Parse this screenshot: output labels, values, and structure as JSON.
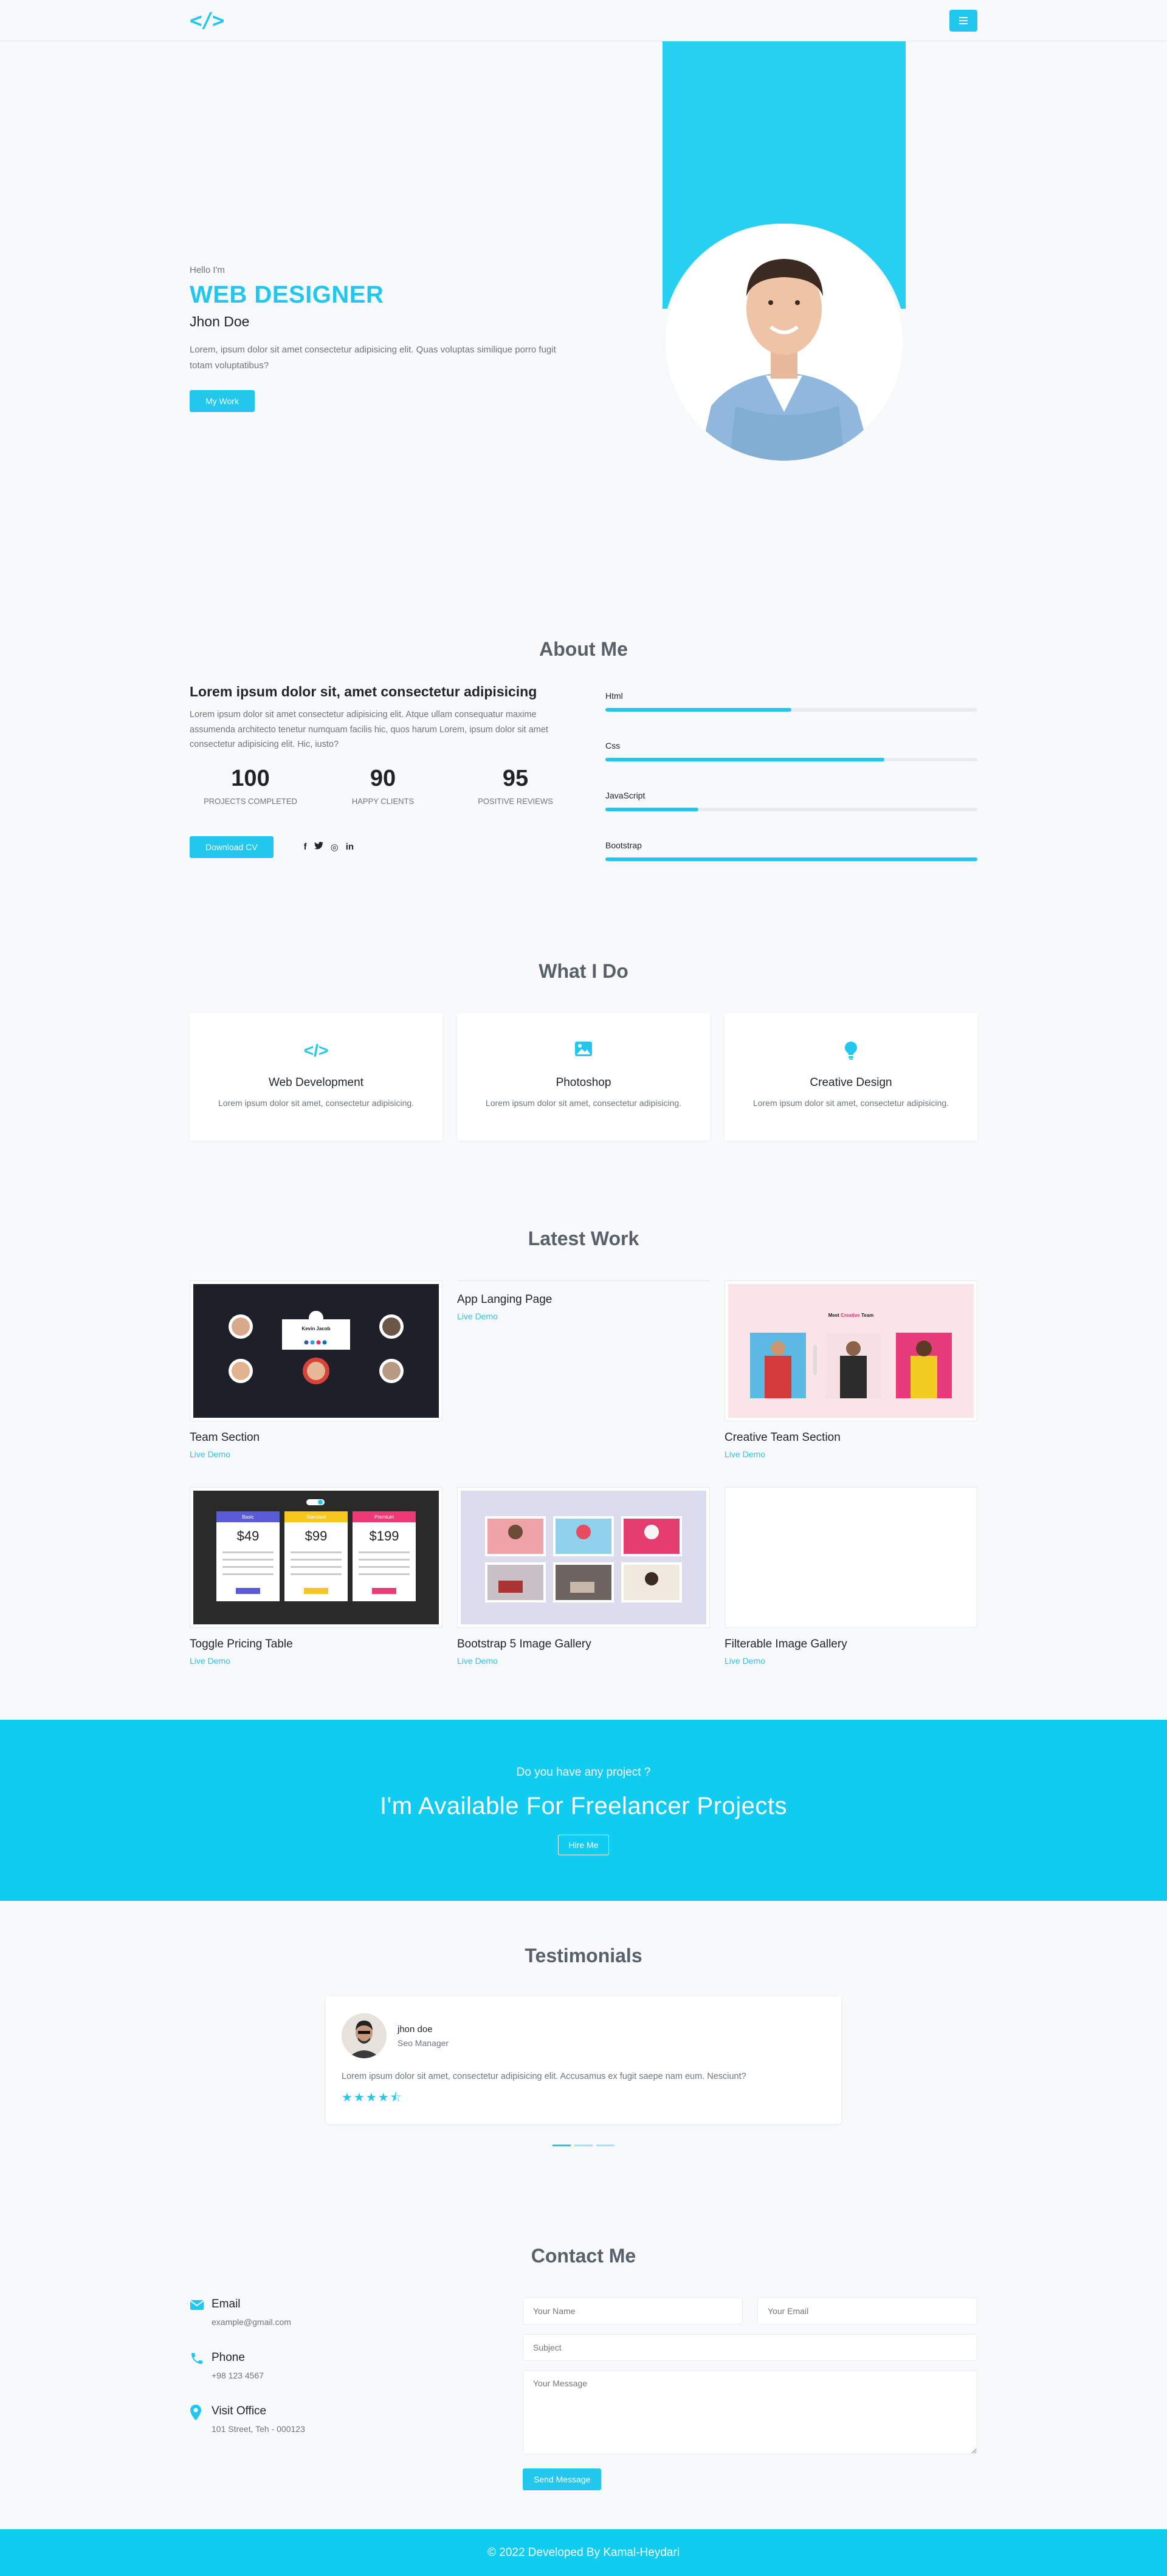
{
  "nav": {
    "logo": "</>",
    "menu_icon": "hamburger-icon"
  },
  "hero": {
    "hello": "Hello I'm",
    "title": "WEB DESIGNER",
    "name": "Jhon Doe",
    "description": "Lorem, ipsum dolor sit amet consectetur adipisicing elit. Quas voluptas similique porro fugit totam voluptatibus?",
    "button": "My Work"
  },
  "about": {
    "title": "About Me",
    "heading": "Lorem ipsum dolor sit, amet consectetur adipisicing",
    "text": "Lorem ipsum dolor sit amet consectetur adipisicing elit. Atque ullam consequatur maxime assumenda architecto tenetur numquam facilis hic, quos harum Lorem, ipsum dolor sit amet consectetur adipisicing elit. Hic, iusto?",
    "stats": [
      {
        "num": "100",
        "label": "PROJECTS COMPLETED"
      },
      {
        "num": "90",
        "label": "HAPPY CLIENTS"
      },
      {
        "num": "95",
        "label": "POSITIVE REVIEWS"
      }
    ],
    "cv_button": "Download CV",
    "socials": [
      "f",
      "🐦",
      "◎",
      "in"
    ],
    "skills": [
      {
        "name": "Html",
        "level": 0.5
      },
      {
        "name": "Css",
        "level": 0.75
      },
      {
        "name": "JavaScript",
        "level": 0.25
      },
      {
        "name": "Bootstrap",
        "level": 1.0
      }
    ]
  },
  "services": {
    "title": "What I Do",
    "items": [
      {
        "icon": "code-icon",
        "glyph": "</>",
        "title": "Web Development",
        "desc": "Lorem ipsum dolor sit amet, consectetur adipisicing."
      },
      {
        "icon": "image-icon",
        "glyph": "▣",
        "title": "Photoshop",
        "desc": "Lorem ipsum dolor sit amet, consectetur adipisicing."
      },
      {
        "icon": "lightbulb-icon",
        "glyph": "💡",
        "title": "Creative Design",
        "desc": "Lorem ipsum dolor sit amet, consectetur adipisicing."
      }
    ]
  },
  "work": {
    "title": "Latest Work",
    "items": [
      {
        "title": "Team Section",
        "link": "Live Demo"
      },
      {
        "title": "App Langing Page",
        "link": "Live Demo"
      },
      {
        "title": "Creative Team Section",
        "link": "Live Demo"
      },
      {
        "title": "Toggle Pricing Table",
        "link": "Live Demo"
      },
      {
        "title": "Bootstrap 5 Image Gallery",
        "link": "Live Demo"
      },
      {
        "title": "Filterable Image Gallery",
        "link": "Live Demo"
      }
    ],
    "thumb_team": {
      "name": "Kevin Jacob"
    },
    "thumb_creative": {
      "heading_a": "Meet ",
      "heading_b": "Creative",
      "heading_c": " Team"
    },
    "thumb_pricing": {
      "plans": [
        {
          "name": "Basic",
          "price": "$49",
          "color": "#5a5bd6"
        },
        {
          "name": "Standard",
          "price": "$99",
          "color": "#f8c61c"
        },
        {
          "name": "Premium",
          "price": "$199",
          "color": "#ee3b78"
        }
      ]
    }
  },
  "cta": {
    "small": "Do you have any project ?",
    "big": "I'm Available For Freelancer Projects",
    "button": "Hire Me"
  },
  "testimonials": {
    "title": "Testimonials",
    "name": "jhon doe",
    "role": "Seo Manager",
    "text": "Lorem ipsum dolor sit amet, consectetur adipisicing elit. Accusamus ex fugit saepe nam eum. Nesciunt?",
    "rating": 4.5,
    "stars": "★★★★⯪"
  },
  "contact": {
    "title": "Contact Me",
    "info": [
      {
        "icon": "envelope-icon",
        "glyph": "✉",
        "title": "Email",
        "value": "example@gmail.com"
      },
      {
        "icon": "phone-icon",
        "glyph": "✆",
        "title": "Phone",
        "value": "+98 123 4567"
      },
      {
        "icon": "location-icon",
        "glyph": "⚲",
        "title": "Visit Office",
        "value": "101 Street, Teh - 000123"
      }
    ],
    "placeholders": {
      "name": "Your Name",
      "email": "Your Email",
      "subject": "Subject",
      "message": "Your Message"
    },
    "button": "Send Message"
  },
  "footer": {
    "text": "© 2022 Developed By Kamal-Heydari"
  },
  "colors": {
    "accent": "#22c7ee",
    "cta_bg": "#10ccf0"
  }
}
